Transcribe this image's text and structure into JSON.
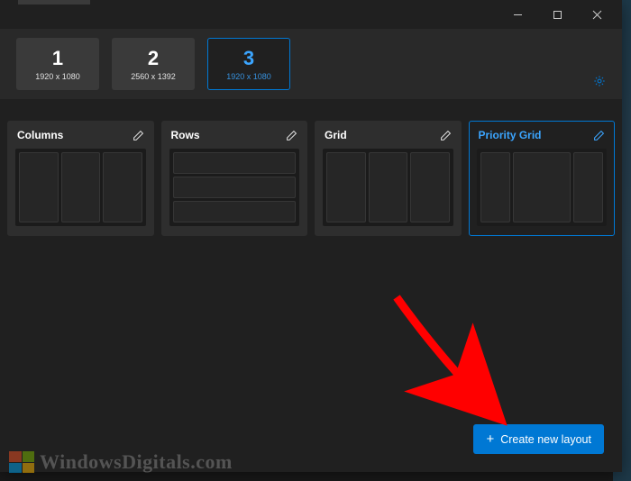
{
  "monitors": [
    {
      "num": "1",
      "res": "1920 x 1080"
    },
    {
      "num": "2",
      "res": "2560 x 1392"
    },
    {
      "num": "3",
      "res": "1920 x 1080"
    }
  ],
  "layouts": {
    "columns": "Columns",
    "rows": "Rows",
    "grid": "Grid",
    "priority": "Priority Grid"
  },
  "create_label": "Create new layout",
  "watermark": "WindowsDigitals.com"
}
